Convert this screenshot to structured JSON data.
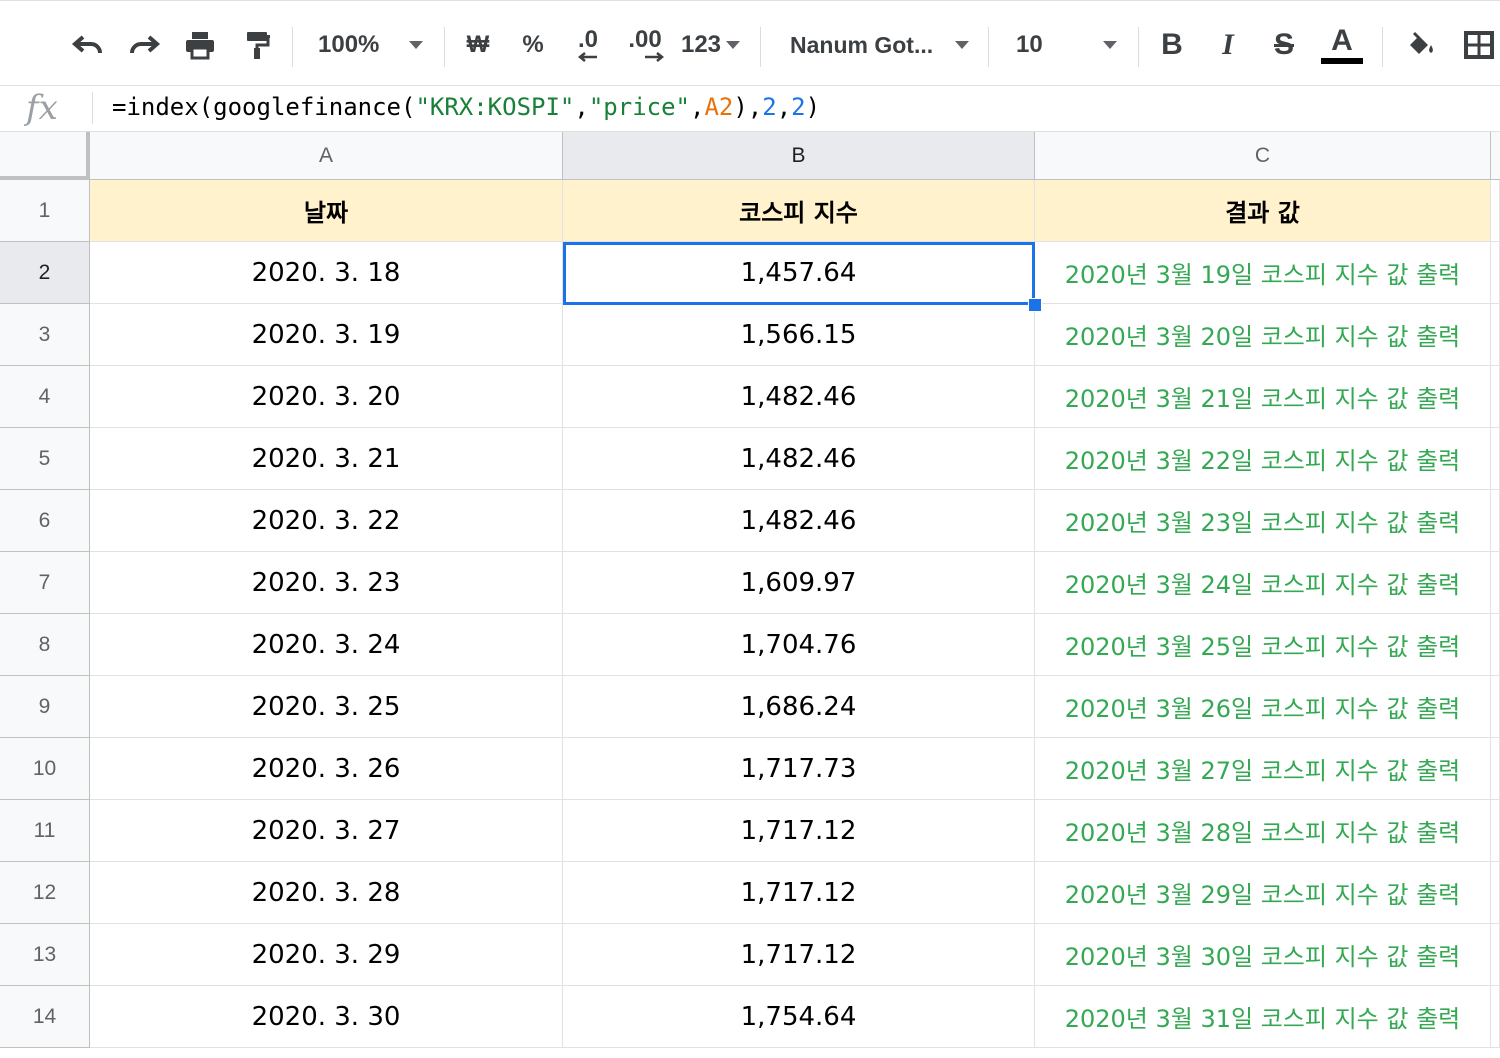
{
  "toolbar": {
    "zoom": "100%",
    "currency": "₩",
    "percent": "%",
    "decrease_decimal": ".0",
    "increase_decimal": ".00",
    "more_formats": "123",
    "font_family": "Nanum Got...",
    "font_size": "10",
    "bold": "B",
    "italic": "I",
    "strikethrough": "S",
    "text_color": "A",
    "text_color_value": "#000000"
  },
  "formula_bar": {
    "fx": "fx",
    "formula": {
      "p1": "=index(googlefinance(",
      "s1": "\"KRX:KOSPI\"",
      "c1": ",",
      "s2": "\"price\"",
      "c2": ",",
      "ref": "A2",
      "c3": "),",
      "n1": "2",
      "c4": ",",
      "n2": "2",
      "c5": ")"
    }
  },
  "sheet": {
    "columns": [
      "A",
      "B",
      "C"
    ],
    "selected_cell": "B2",
    "header_fill": "#fff2cc",
    "result_color": "#34a853",
    "rows": [
      {
        "n": "1",
        "a": "날짜",
        "b": "코스피 지수",
        "c": "결과 값"
      },
      {
        "n": "2",
        "a": "2020. 3. 18",
        "b": "1,457.64",
        "c": "2020년 3월 19일 코스피 지수 값 출력"
      },
      {
        "n": "3",
        "a": "2020. 3. 19",
        "b": "1,566.15",
        "c": "2020년 3월 20일 코스피 지수 값 출력"
      },
      {
        "n": "4",
        "a": "2020. 3. 20",
        "b": "1,482.46",
        "c": "2020년 3월 21일 코스피 지수 값 출력"
      },
      {
        "n": "5",
        "a": "2020. 3. 21",
        "b": "1,482.46",
        "c": "2020년 3월 22일 코스피 지수 값 출력"
      },
      {
        "n": "6",
        "a": "2020. 3. 22",
        "b": "1,482.46",
        "c": "2020년 3월 23일 코스피 지수 값 출력"
      },
      {
        "n": "7",
        "a": "2020. 3. 23",
        "b": "1,609.97",
        "c": "2020년 3월 24일 코스피 지수 값 출력"
      },
      {
        "n": "8",
        "a": "2020. 3. 24",
        "b": "1,704.76",
        "c": "2020년 3월 25일 코스피 지수 값 출력"
      },
      {
        "n": "9",
        "a": "2020. 3. 25",
        "b": "1,686.24",
        "c": "2020년 3월 26일 코스피 지수 값 출력"
      },
      {
        "n": "10",
        "a": "2020. 3. 26",
        "b": "1,717.73",
        "c": "2020년 3월 27일 코스피 지수 값 출력"
      },
      {
        "n": "11",
        "a": "2020. 3. 27",
        "b": "1,717.12",
        "c": "2020년 3월 28일 코스피 지수 값 출력"
      },
      {
        "n": "12",
        "a": "2020. 3. 28",
        "b": "1,717.12",
        "c": "2020년 3월 29일 코스피 지수 값 출력"
      },
      {
        "n": "13",
        "a": "2020. 3. 29",
        "b": "1,717.12",
        "c": "2020년 3월 30일 코스피 지수 값 출력"
      },
      {
        "n": "14",
        "a": "2020. 3. 30",
        "b": "1,754.64",
        "c": "2020년 3월 31일 코스피 지수 값 출력"
      }
    ]
  }
}
